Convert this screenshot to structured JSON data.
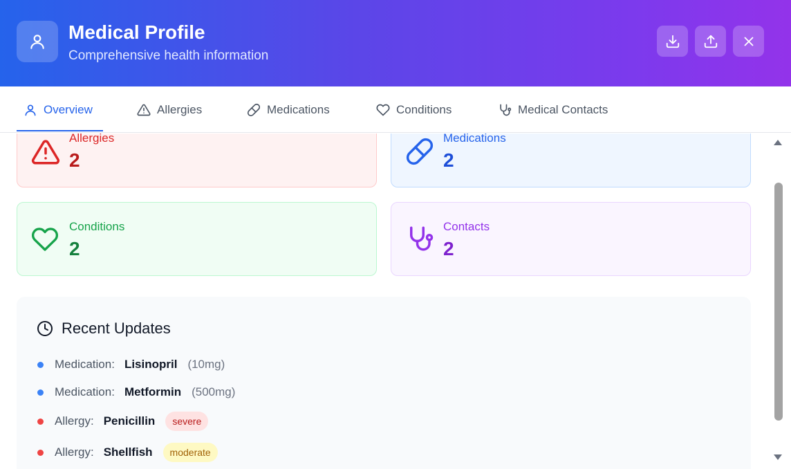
{
  "header": {
    "title": "Medical Profile",
    "subtitle": "Comprehensive health information",
    "icons": {
      "avatar": "user-icon",
      "download": "download-icon",
      "upload": "upload-icon",
      "close": "close-icon"
    }
  },
  "tabs": [
    {
      "label": "Overview",
      "icon": "user-icon",
      "active": true
    },
    {
      "label": "Allergies",
      "icon": "warning-icon",
      "active": false
    },
    {
      "label": "Medications",
      "icon": "pill-icon",
      "active": false
    },
    {
      "label": "Conditions",
      "icon": "heart-icon",
      "active": false
    },
    {
      "label": "Medical Contacts",
      "icon": "stethoscope-icon",
      "active": false
    }
  ],
  "stats": {
    "allergies": {
      "label": "Allergies",
      "count": "2",
      "color": "#dc2626",
      "countColor": "#b91c1c"
    },
    "medications": {
      "label": "Medications",
      "count": "2",
      "color": "#2563eb",
      "countColor": "#1d4ed8"
    },
    "conditions": {
      "label": "Conditions",
      "count": "2",
      "color": "#16a34a",
      "countColor": "#15803d"
    },
    "contacts": {
      "label": "Contacts",
      "count": "2",
      "color": "#9333ea",
      "countColor": "#7e22ce"
    }
  },
  "recent": {
    "title": "Recent Updates",
    "items": [
      {
        "type": "Medication:",
        "name": "Lisinopril",
        "detail": "(10mg)",
        "dotColor": "#3b82f6"
      },
      {
        "type": "Medication:",
        "name": "Metformin",
        "detail": "(500mg)",
        "dotColor": "#3b82f6"
      },
      {
        "type": "Allergy:",
        "name": "Penicillin",
        "badge": "severe",
        "dotColor": "#ef4444",
        "badgeBg": "#fee2e2",
        "badgeColor": "#b91c1c"
      },
      {
        "type": "Allergy:",
        "name": "Shellfish",
        "badge": "moderate",
        "dotColor": "#ef4444",
        "badgeBg": "#fef9c3",
        "badgeColor": "#a16207"
      }
    ]
  }
}
